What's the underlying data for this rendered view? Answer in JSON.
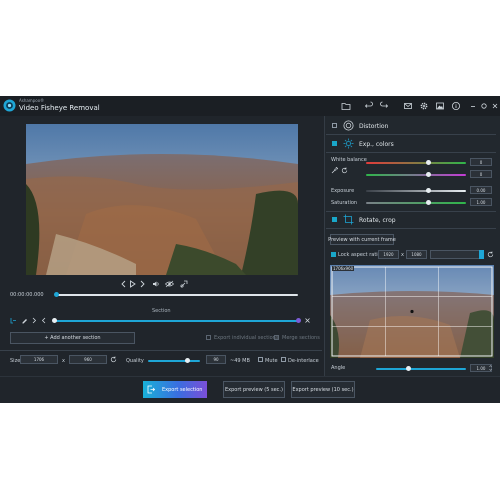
{
  "app": {
    "brand_small": "Ashampoo®",
    "title": "Video Fisheye Removal"
  },
  "colors": {
    "accent": "#1ea6d6",
    "bg": "#20252b",
    "panel": "#262c33"
  },
  "player": {
    "time": "00:00:00.000",
    "section_label": "Section",
    "add_section_label": "+ Add another section",
    "export_individual_label": "Export individual sections",
    "merge_sections_label": "Merge sections"
  },
  "output": {
    "size_label": "Size",
    "width": "1706",
    "x_sep": "x",
    "height": "960",
    "quality_label": "Quality",
    "quality_value": "90",
    "file_size": "~49 MB",
    "mute_label": "Mute",
    "deinterlace_label": "De-interlace"
  },
  "buttons": {
    "export_selection": "Export selection",
    "export_preview_5": "Export preview (5 sec.)",
    "export_preview_10": "Export preview (10 sec.)"
  },
  "panel": {
    "distortion": {
      "title": "Distortion"
    },
    "exp_colors": {
      "title": "Exp., colors",
      "white_balance_label": "White balance",
      "wb_value_1": "0",
      "wb_value_2": "0",
      "exposure_label": "Exposure",
      "exposure_value": "0.00",
      "saturation_label": "Saturation",
      "saturation_value": "1.00"
    },
    "rotate_crop": {
      "title": "Rotate, crop",
      "preview_button": "Preview with current frame",
      "lock_aspect_label": "Lock aspect ratio",
      "ratio_w": "1920",
      "ratio_sep": "x",
      "ratio_h": "1080",
      "crop_tag": "1706x960",
      "angle_label": "Angle",
      "angle_value": "1.00"
    }
  },
  "sliders": {
    "timeline_position": 0.0,
    "section_end": 1.0,
    "quality_fraction": 0.75,
    "wb1_fraction": 0.62,
    "wb2_fraction": 0.62,
    "exposure_fraction": 0.62,
    "saturation_fraction": 0.62,
    "angle_fraction": 0.36
  }
}
